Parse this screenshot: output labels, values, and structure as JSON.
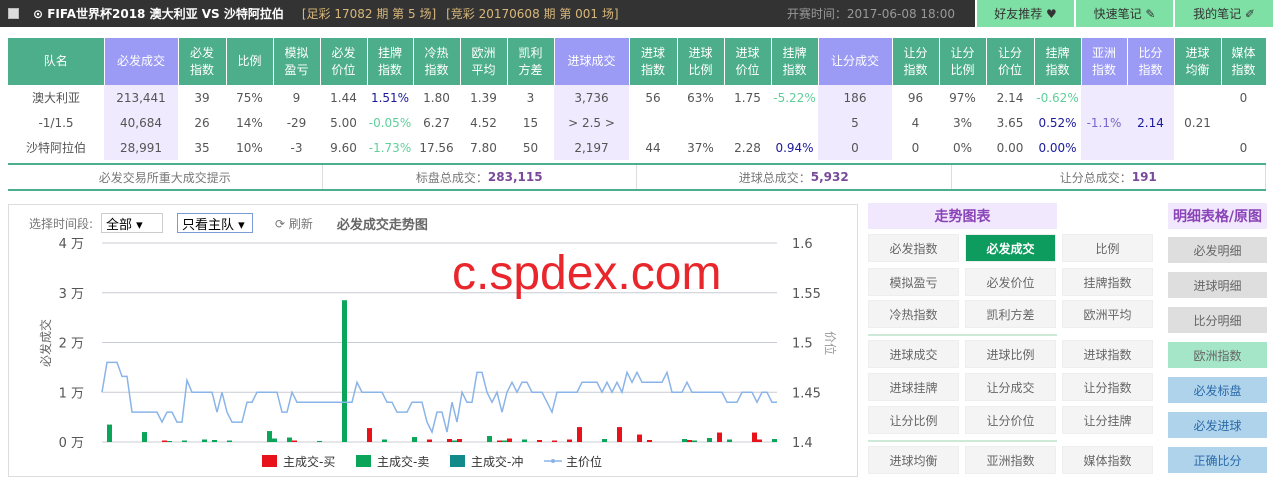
{
  "header": {
    "title": "⊙ FIFA世界杯2018  澳大利亚  VS 沙特阿拉伯",
    "zucai": "[足彩 17082 期 第 5 场]",
    "jingcai": "[竞彩 20170608 期 第 001 场]",
    "start_time": "开赛时间：2017-06-08 18:00",
    "buttons": [
      "好友推荐 ♥",
      "快速笔记 ✎",
      "我的笔记 ✐"
    ]
  },
  "table": {
    "headers": [
      "队名",
      "必发成交",
      "必发\n指数",
      "比例",
      "模拟\n盈亏",
      "必发\n价位",
      "挂牌\n指数",
      "冷热\n指数",
      "欧洲\n平均",
      "凯利\n方差",
      "进球成交",
      "进球\n指数",
      "进球\n比例",
      "进球\n价位",
      "挂牌\n指数",
      "让分成交",
      "让分\n指数",
      "让分\n比例",
      "让分\n价位",
      "挂牌\n指数",
      "亚洲\n指数",
      "比分\n指数",
      "进球\n均衡",
      "媒体\n指数"
    ],
    "rows": [
      [
        "澳大利亚",
        "213,441",
        "39",
        "75%",
        "9",
        "1.44",
        "1.51%",
        "1.80",
        "1.39",
        "3",
        "3,736",
        "56",
        "63%",
        "1.75",
        "-5.22%",
        "186",
        "96",
        "97%",
        "2.14",
        "-0.62%",
        "",
        "",
        "",
        "0"
      ],
      [
        "-1/1.5",
        "40,684",
        "26",
        "14%",
        "-29",
        "5.00",
        "-0.05%",
        "6.27",
        "4.52",
        "15",
        "> 2.5 >",
        "",
        "",
        "",
        "",
        "5",
        "4",
        "3%",
        "3.65",
        "0.52%",
        "-1.1%",
        "2.14",
        "0.21",
        ""
      ],
      [
        "沙特阿拉伯",
        "28,991",
        "35",
        "10%",
        "-3",
        "9.60",
        "-1.73%",
        "17.56",
        "7.80",
        "50",
        "2,197",
        "44",
        "37%",
        "2.28",
        "0.94%",
        "0",
        "0",
        "0%",
        "0.00",
        "0.00%",
        "",
        "",
        "",
        "0"
      ]
    ]
  },
  "summary": {
    "tip": "必发交易所重大成交提示",
    "total_label": "标盘总成交：",
    "total": "283,115",
    "goal_label": "进球总成交：",
    "goal": "5,932",
    "hcp_label": "让分总成交：",
    "hcp": "191"
  },
  "controls": {
    "period_label": "选择时间段:",
    "period": "全部 ▾",
    "team": "只看主队 ▾",
    "refresh": "⟳ 刷新",
    "chart_title": "必发成交走势图"
  },
  "watermark": "c.spdex.com",
  "chart_data": {
    "type": "bar+line",
    "ylabel": "必发成交",
    "y2label": "价位",
    "ylim": [
      0,
      40000
    ],
    "y2lim": [
      1.4,
      1.6
    ],
    "yticks": [
      "0 万",
      "1 万",
      "2 万",
      "3 万",
      "4 万"
    ],
    "y2ticks": [
      "1.4",
      "1.45",
      "1.5",
      "1.55",
      "1.6"
    ],
    "legend": [
      "主成交-买",
      "主成交-卖",
      "主成交-冲",
      "主价位"
    ],
    "colors": {
      "buy": "#e8121b",
      "sell": "#0aa558",
      "hedge": "#128a8a",
      "price": "#8ab4e8"
    },
    "price": [
      1.45,
      1.48,
      1.48,
      1.48,
      1.466,
      1.466,
      1.43,
      1.43,
      1.43,
      1.43,
      1.43,
      1.43,
      1.42,
      1.43,
      1.43,
      1.42,
      1.42,
      1.462,
      1.45,
      1.45,
      1.45,
      1.45,
      1.45,
      1.43,
      1.45,
      1.43,
      1.42,
      1.42,
      1.42,
      1.44,
      1.44,
      1.45,
      1.45,
      1.45,
      1.45,
      1.45,
      1.43,
      1.43,
      1.45,
      1.44,
      1.44,
      1.44,
      1.44,
      1.44,
      1.44,
      1.44,
      1.44,
      1.44,
      1.44,
      1.44,
      1.44,
      1.46,
      1.45,
      1.45,
      1.45,
      1.45,
      1.45,
      1.44,
      1.44,
      1.43,
      1.43,
      1.43,
      1.44,
      1.44,
      1.44,
      1.42,
      1.41,
      1.43,
      1.43,
      1.41,
      1.44,
      1.42,
      1.45,
      1.44,
      1.44,
      1.47,
      1.47,
      1.45,
      1.44,
      1.45,
      1.43,
      1.45,
      1.46,
      1.45,
      1.46,
      1.46,
      1.45,
      1.45,
      1.45,
      1.44,
      1.43,
      1.45,
      1.45,
      1.45,
      1.45,
      1.45,
      1.46,
      1.46,
      1.46,
      1.46,
      1.45,
      1.46,
      1.45,
      1.46,
      1.45,
      1.47,
      1.46,
      1.47,
      1.46,
      1.46,
      1.46,
      1.46,
      1.46,
      1.47,
      1.45,
      1.45,
      1.45,
      1.46,
      1.45,
      1.45,
      1.45,
      1.45,
      1.45,
      1.45,
      1.45,
      1.44,
      1.44,
      1.44,
      1.45,
      1.45,
      1.45,
      1.44,
      1.45,
      1.45,
      1.44,
      1.44
    ],
    "bars": [
      [
        1,
        0,
        3500
      ],
      [
        8,
        0,
        2000
      ],
      [
        13,
        300,
        200
      ],
      [
        16,
        0,
        300
      ],
      [
        20,
        0,
        500
      ],
      [
        22,
        0,
        400
      ],
      [
        25,
        0,
        300
      ],
      [
        33,
        0,
        2200
      ],
      [
        34,
        0,
        700
      ],
      [
        37,
        0,
        900
      ],
      [
        39,
        300,
        0
      ],
      [
        43,
        0,
        200
      ],
      [
        48,
        0,
        28500
      ],
      [
        54,
        2800,
        0
      ],
      [
        56,
        0,
        500
      ],
      [
        62,
        0,
        1000
      ],
      [
        66,
        500,
        0
      ],
      [
        70,
        600,
        300
      ],
      [
        72,
        600,
        0
      ],
      [
        77,
        0,
        1200
      ],
      [
        80,
        300,
        300
      ],
      [
        82,
        700,
        0
      ],
      [
        84,
        0,
        500
      ],
      [
        88,
        400,
        0
      ],
      [
        91,
        300,
        0
      ],
      [
        94,
        500,
        0
      ],
      [
        96,
        3000,
        0
      ],
      [
        100,
        0,
        600
      ],
      [
        104,
        3000,
        0
      ],
      [
        108,
        1500,
        0
      ],
      [
        110,
        400,
        0
      ],
      [
        116,
        0,
        600
      ],
      [
        118,
        400,
        300
      ],
      [
        121,
        0,
        800
      ],
      [
        124,
        1900,
        0
      ],
      [
        125,
        0,
        500
      ],
      [
        131,
        1900,
        0
      ],
      [
        132,
        500,
        0
      ],
      [
        134,
        0,
        600
      ]
    ]
  },
  "trend": {
    "title": "走势图表",
    "buttons": [
      "必发指数",
      "必发成交",
      "比例",
      "模拟盈亏",
      "必发价位",
      "挂牌指数",
      "冷热指数",
      "凯利方差",
      "欧洲平均",
      "进球成交",
      "进球比例",
      "进球指数",
      "进球挂牌",
      "让分成交",
      "让分指数",
      "让分比例",
      "让分价位",
      "让分挂牌",
      "进球均衡",
      "亚洲指数",
      "媒体指数"
    ],
    "active": 1
  },
  "detail": {
    "title": "明细表格/原图",
    "buttons": [
      "必发明细",
      "进球明细",
      "比分明细",
      "欧洲指数",
      "必发标盘",
      "必发进球",
      "正确比分"
    ]
  }
}
